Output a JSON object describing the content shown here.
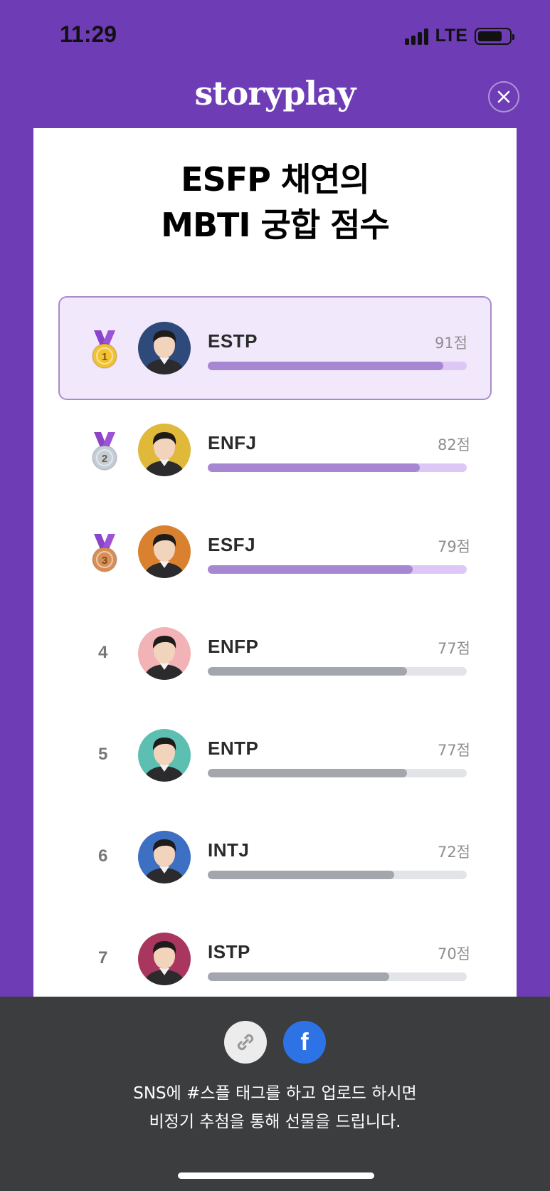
{
  "status_bar": {
    "time": "11:29",
    "network": "LTE",
    "battery_level": 0.78
  },
  "header": {
    "logo_text": "storyplay",
    "close_icon": "close-icon"
  },
  "card": {
    "title_line1": "ESFP 채연의",
    "title_line2": "MBTI 궁합 점수"
  },
  "ranking": [
    {
      "rank": "1",
      "mbti": "ESTP",
      "score_text": "91점",
      "score": 91,
      "medal": "gold",
      "avatar_bg": "#2E4A7A"
    },
    {
      "rank": "2",
      "mbti": "ENFJ",
      "score_text": "82점",
      "score": 82,
      "medal": "silver",
      "avatar_bg": "#E0B83A"
    },
    {
      "rank": "3",
      "mbti": "ESFJ",
      "score_text": "79점",
      "score": 79,
      "medal": "bronze",
      "avatar_bg": "#D9812F"
    },
    {
      "rank": "4",
      "mbti": "ENFP",
      "score_text": "77점",
      "score": 77,
      "medal": "",
      "avatar_bg": "#F1B3B6"
    },
    {
      "rank": "5",
      "mbti": "ENTP",
      "score_text": "77점",
      "score": 77,
      "medal": "",
      "avatar_bg": "#5DBFB2"
    },
    {
      "rank": "6",
      "mbti": "INTJ",
      "score_text": "72점",
      "score": 72,
      "medal": "",
      "avatar_bg": "#3D6FC2"
    },
    {
      "rank": "7",
      "mbti": "ISTP",
      "score_text": "70점",
      "score": 70,
      "medal": "",
      "avatar_bg": "#A8365F"
    }
  ],
  "colors": {
    "brand_purple": "#6E3DB6",
    "bar_top_fill": "#A887D2",
    "bar_top_track": "#DCC7F7",
    "bar_rest_fill": "#A3A6AC",
    "bar_rest_track": "#E3E4E7",
    "gold": "#F2C230",
    "silver": "#C5CDD6",
    "bronze": "#D98E56",
    "facebook": "#2D73E6"
  },
  "footer": {
    "link_icon": "link-icon",
    "facebook_label": "f",
    "notice_line1": "SNS에 #스플 태그를 하고 업로드 하시면",
    "notice_line2": "비정기 추첨을 통해 선물을 드립니다."
  }
}
